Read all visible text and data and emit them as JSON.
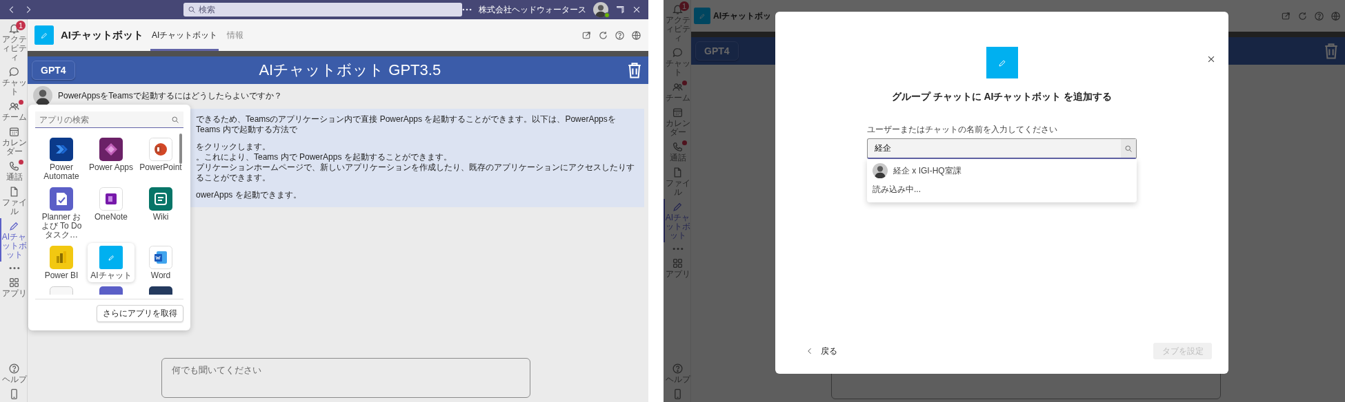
{
  "left_screen": {
    "title_bar": {
      "search_placeholder": "検索",
      "org": "株式会社ヘッドウォータース"
    },
    "rail": [
      {
        "label": "アクティビティ",
        "badge": "1",
        "dot": false,
        "selected": false
      },
      {
        "label": "チャット",
        "dot": false,
        "selected": false
      },
      {
        "label": "チーム",
        "dot": true,
        "selected": false
      },
      {
        "label": "カレンダー",
        "dot": false,
        "selected": false
      },
      {
        "label": "通話",
        "dot": true,
        "selected": false
      },
      {
        "label": "ファイル",
        "dot": false,
        "selected": false
      },
      {
        "label": "AIチャットボット",
        "dot": false,
        "selected": true
      },
      {
        "dot": false,
        "selected": false
      },
      {
        "label": "アプリ",
        "dot": false,
        "selected": false
      }
    ],
    "rail_bottom": [
      {
        "label": "ヘルプ"
      }
    ],
    "header": {
      "app_name": "AIチャットボット",
      "tabs": [
        {
          "label": "AIチャットボット",
          "selected": true
        },
        {
          "label": "情報",
          "selected": false
        }
      ]
    },
    "banner": {
      "model_button": "GPT4",
      "title": "AIチャットボット GPT3.5"
    },
    "question": "PowerAppsをTeamsで起動するにはどうしたらよいですか？",
    "answer": [
      [
        "できるため、Teamsのアプリケーション内で直接 PowerApps を起動することができます。以下は、PowerAppsを Teams 内で起動する方法で"
      ],
      [
        "をクリックします。",
        "。これにより、Teams 内で PowerApps を起動することができます。",
        "プリケーションホームページで、新しいアプリケーションを作成したり、既存のアプリケーションにアクセスしたりすることができます。"
      ],
      [
        "owerApps を起動できます。"
      ]
    ],
    "app_picker": {
      "search_placeholder": "アプリの検索",
      "apps": [
        {
          "name": "Power Automate",
          "selected": false
        },
        {
          "name": "Power Apps",
          "selected": false
        },
        {
          "name": "PowerPoint",
          "selected": false
        },
        {
          "name": "Planner および To Do タスク…",
          "selected": false
        },
        {
          "name": "OneNote",
          "selected": false
        },
        {
          "name": "Wiki",
          "selected": false
        },
        {
          "name": "Power BI",
          "selected": false
        },
        {
          "name": "AIチャット",
          "selected": true
        },
        {
          "name": "Word",
          "selected": false
        }
      ],
      "more_button": "さらにアプリを取得"
    },
    "chat_input": {
      "placeholder": "何でも聞いてください"
    }
  },
  "right_screen": {
    "rail": [
      {
        "label": "アクティビティ",
        "badge": "1",
        "dot": false,
        "selected": false
      },
      {
        "label": "チャット",
        "dot": false,
        "selected": false
      },
      {
        "label": "チーム",
        "dot": true,
        "selected": false
      },
      {
        "label": "カレンダー",
        "dot": false,
        "selected": false
      },
      {
        "label": "通話",
        "dot": true,
        "selected": false
      },
      {
        "label": "ファイル",
        "dot": false,
        "selected": false
      },
      {
        "label": "AIチャットボット",
        "dot": false,
        "selected": true
      },
      {
        "dot": false,
        "selected": false
      },
      {
        "label": "アプリ",
        "dot": false,
        "selected": false
      }
    ],
    "rail_bottom": [
      {
        "label": "ヘルプ"
      }
    ],
    "header": {
      "app_name": "AIチャットボッ"
    },
    "banner": {
      "model_button": "GPT4"
    },
    "dialog": {
      "title": "グループ チャットに AIチャットボット を追加する",
      "field_label": "ユーザーまたはチャットの名前を入力してください",
      "field_value": "経企",
      "suggestions": [
        {
          "name": "経企 x IGI-HQ室課"
        }
      ],
      "status": "読み込み中...",
      "back_link": "戻る",
      "submit_button": {
        "label": "タブを設定",
        "disabled": true
      }
    }
  }
}
